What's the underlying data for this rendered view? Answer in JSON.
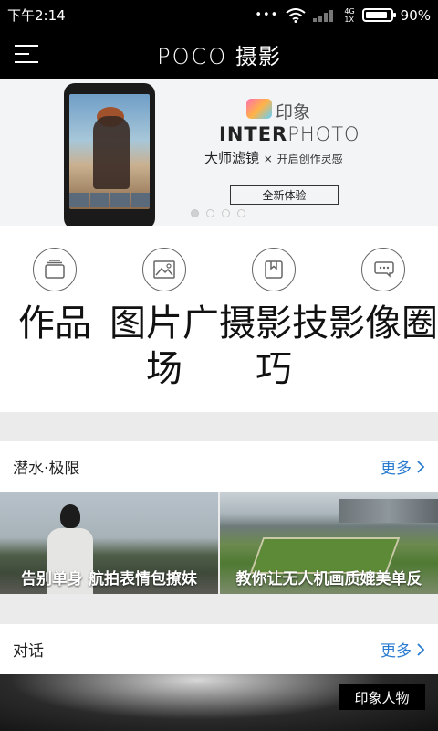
{
  "status_bar": {
    "time": "下午2:14",
    "network_top": "4G",
    "network_bottom": "1X",
    "battery_percent": "90%",
    "battery_level": 0.9
  },
  "app_bar": {
    "title_logo": "POCO",
    "title_text": "摄影",
    "menu_icon": "menu-icon"
  },
  "banner": {
    "brand_cn": "印象",
    "brand_en_bold": "INTER",
    "brand_en_light": "PHOTO",
    "tagline_main": "大师滤镜",
    "tagline_sep": "×",
    "tagline_sub": "开启创作灵感",
    "button_label": "全新体验",
    "page_count": 4,
    "active_page": 1
  },
  "categories": [
    {
      "icon": "works-icon",
      "label": "作品"
    },
    {
      "icon": "image-icon",
      "label": "图片广场"
    },
    {
      "icon": "bookmark-icon",
      "label": "摄影技巧"
    },
    {
      "icon": "chat-icon",
      "label": "影像圈"
    }
  ],
  "section1": {
    "title": "潜水·极限",
    "more": "更多",
    "items": [
      {
        "caption": "告别单身 航拍表情包撩妹"
      },
      {
        "caption": "教你让无人机画质媲美单反"
      }
    ]
  },
  "section2": {
    "title": "对话",
    "more": "更多",
    "tag": "印象人物"
  }
}
